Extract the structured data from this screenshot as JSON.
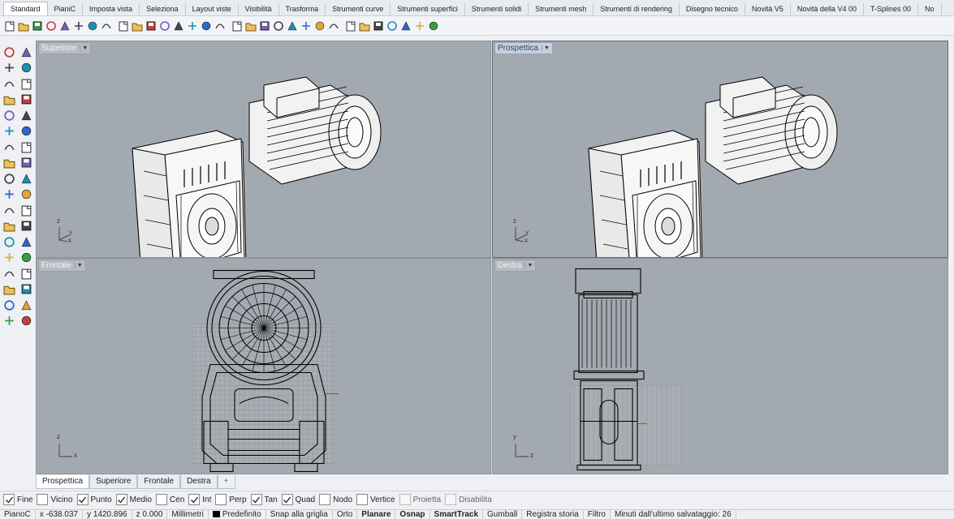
{
  "tabs": [
    {
      "label": "Standard",
      "active": true
    },
    {
      "label": "PianiC"
    },
    {
      "label": "Imposta vista"
    },
    {
      "label": "Seleziona"
    },
    {
      "label": "Layout viste"
    },
    {
      "label": "Visibilità"
    },
    {
      "label": "Trasforma"
    },
    {
      "label": "Strumenti curve"
    },
    {
      "label": "Strumenti superfici"
    },
    {
      "label": "Strumenti solidi"
    },
    {
      "label": "Strumenti mesh"
    },
    {
      "label": "Strumenti di rendering"
    },
    {
      "label": "Disegno tecnico"
    },
    {
      "label": "Novità V5"
    },
    {
      "label": "Novità della V4 00"
    },
    {
      "label": "T-Splines 00"
    },
    {
      "label": "No"
    }
  ],
  "toolbar_icons": [
    "new-icon",
    "open-icon",
    "save-icon",
    "print-icon",
    "import-icon",
    "cut-icon",
    "copy-icon",
    "paste-icon",
    "undo-icon",
    "pan-icon",
    "rotate-view-icon",
    "zoom-icon",
    "zoom-window-icon",
    "zoom-extents-icon",
    "zoom-selected-icon",
    "undo-view-icon",
    "grid-icon",
    "car-icon",
    "hide-icon",
    "show-icon",
    "light-icon",
    "lock-icon",
    "layer-icon",
    "color-icon",
    "shade-icon",
    "render-icon",
    "sphere-icon",
    "sun-icon",
    "tools-icon",
    "options-icon",
    "help-icon"
  ],
  "left_tools": [
    "select-icon",
    "point-icon",
    "polyline-icon",
    "curve-icon",
    "circle-icon",
    "ellipse-icon",
    "arc-icon",
    "rectangle-icon",
    "polygon-icon",
    "free-curve-icon",
    "surface-icon",
    "loft-icon",
    "box-icon",
    "sphere-solid-icon",
    "cylinder-icon",
    "extrude-icon",
    "boolean-icon",
    "explode-icon",
    "trim-icon",
    "split-icon",
    "fillet-icon",
    "offset-icon",
    "move-icon",
    "rotate-icon",
    "text-icon",
    "dimension-icon",
    "group-icon",
    "mirror-icon",
    "mesh-icon",
    "measure-icon",
    "array-icon",
    "align-icon",
    "layer-tool-icon",
    "check-icon",
    "render-tool-icon",
    "paint-icon"
  ],
  "viewports": [
    {
      "name": "top",
      "label": "Superiore",
      "axis_vertical": "z",
      "axis_horizontal": "y",
      "axis_third": "x"
    },
    {
      "name": "perspective",
      "label": "Prospettica",
      "active": true,
      "axis_vertical": "z",
      "axis_horizontal": "y",
      "axis_third": "x"
    },
    {
      "name": "front",
      "label": "Frontale",
      "axis_vertical": "z",
      "axis_horizontal": "x"
    },
    {
      "name": "right",
      "label": "Destra",
      "axis_vertical": "y",
      "axis_horizontal": "z"
    }
  ],
  "viewport_tabs": [
    "Prospettica",
    "Superiore",
    "Frontale",
    "Destra"
  ],
  "viewport_tab_add": "+",
  "osnaps": [
    {
      "label": "Fine",
      "checked": true
    },
    {
      "label": "Vicino",
      "checked": false
    },
    {
      "label": "Punto",
      "checked": true
    },
    {
      "label": "Medio",
      "checked": true
    },
    {
      "label": "Cen",
      "checked": false
    },
    {
      "label": "Int",
      "checked": true
    },
    {
      "label": "Perp",
      "checked": false
    },
    {
      "label": "Tan",
      "checked": true
    },
    {
      "label": "Quad",
      "checked": true
    },
    {
      "label": "Nodo",
      "checked": false
    },
    {
      "label": "Vertice",
      "checked": false
    },
    {
      "label": "Proietta",
      "checked": false,
      "disabled": true
    },
    {
      "label": "Disabilita",
      "checked": false,
      "disabled": true
    }
  ],
  "status": {
    "plane": "PianoC",
    "x": "x -638.037",
    "y": "y 1420.896",
    "z": "z 0.000",
    "units": "Millimetri",
    "layer": "Predefinito",
    "snap": "Snap alla griglia",
    "ortho": "Orto",
    "planar": "Planare",
    "osnap": "Osnap",
    "smarttrack": "SmartTrack",
    "gumball": "Gumball",
    "history": "Registra storia",
    "filter": "Filtro",
    "autosave": "Minuti dall'ultimo salvataggio: 26"
  },
  "colors": {
    "viewport_bg": "#a3a9b0",
    "wire": "#000000",
    "model_fill": "#f2f2f2",
    "active_label": "#27476e"
  }
}
